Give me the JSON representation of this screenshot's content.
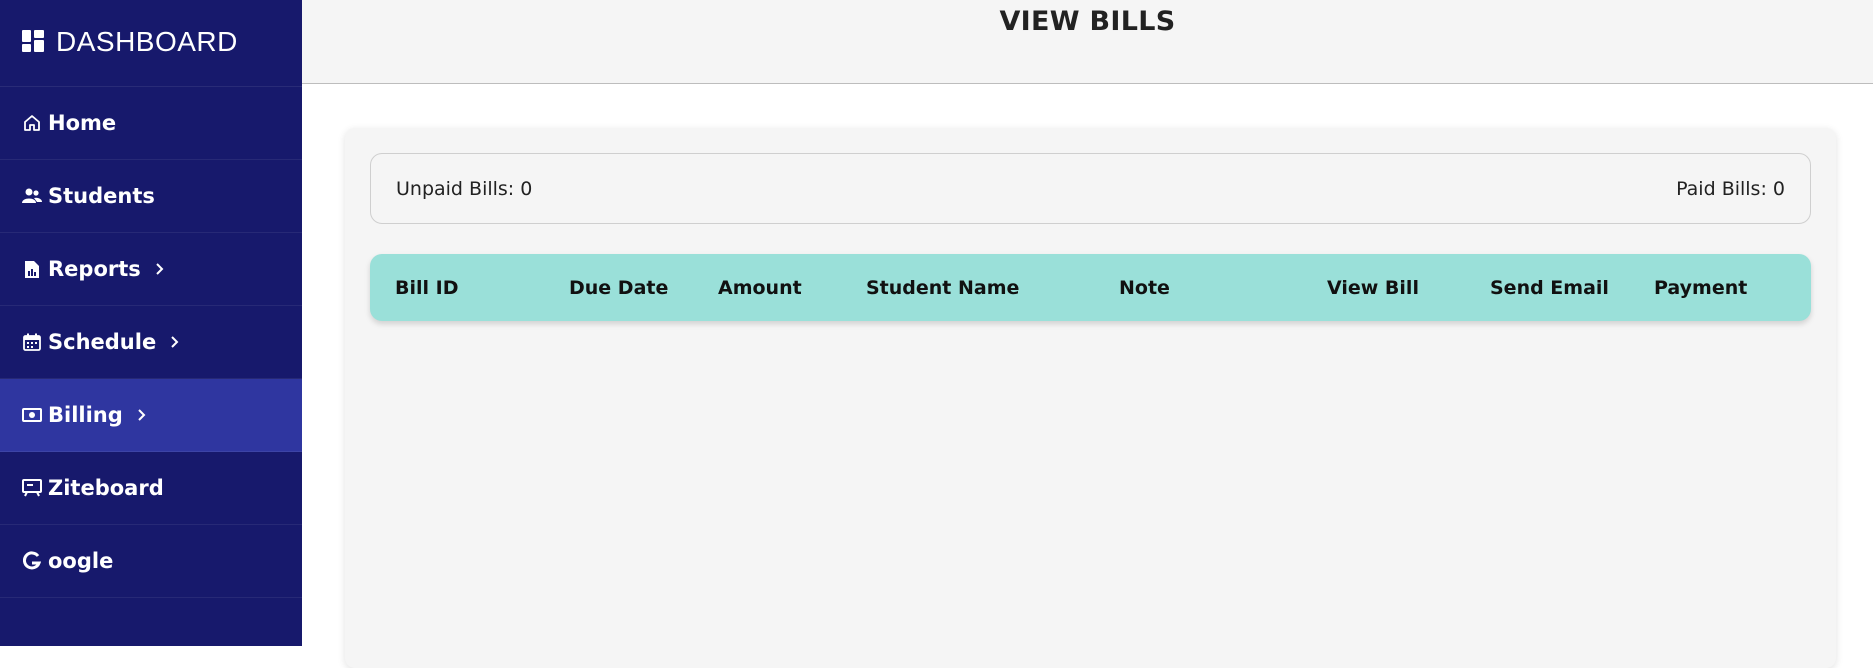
{
  "sidebar": {
    "brand": "DASHBOARD",
    "items": [
      {
        "label": "Home",
        "icon": "home-icon",
        "chevron": false
      },
      {
        "label": "Students",
        "icon": "users-icon",
        "chevron": false
      },
      {
        "label": "Reports",
        "icon": "report-icon",
        "chevron": true
      },
      {
        "label": "Schedule",
        "icon": "calendar-icon",
        "chevron": true
      },
      {
        "label": "Billing",
        "icon": "cash-icon",
        "chevron": true,
        "active": true
      },
      {
        "label": "Ziteboard",
        "icon": "presentation-icon",
        "chevron": false
      },
      {
        "label": "oogle",
        "icon": "google-icon",
        "chevron": false
      }
    ]
  },
  "header": {
    "title": "VIEW BILLS"
  },
  "summary": {
    "unpaid": "Unpaid Bills: 0",
    "paid": "Paid Bills: 0"
  },
  "table": {
    "columns": [
      "Bill ID",
      "Due Date",
      "Amount",
      "Student Name",
      "Note",
      "View Bill",
      "Send Email",
      "Payment"
    ]
  },
  "colors": {
    "sidebar": "#17196c",
    "sidebar_active": "#2f36a0",
    "table_header": "#9ae0d9"
  }
}
